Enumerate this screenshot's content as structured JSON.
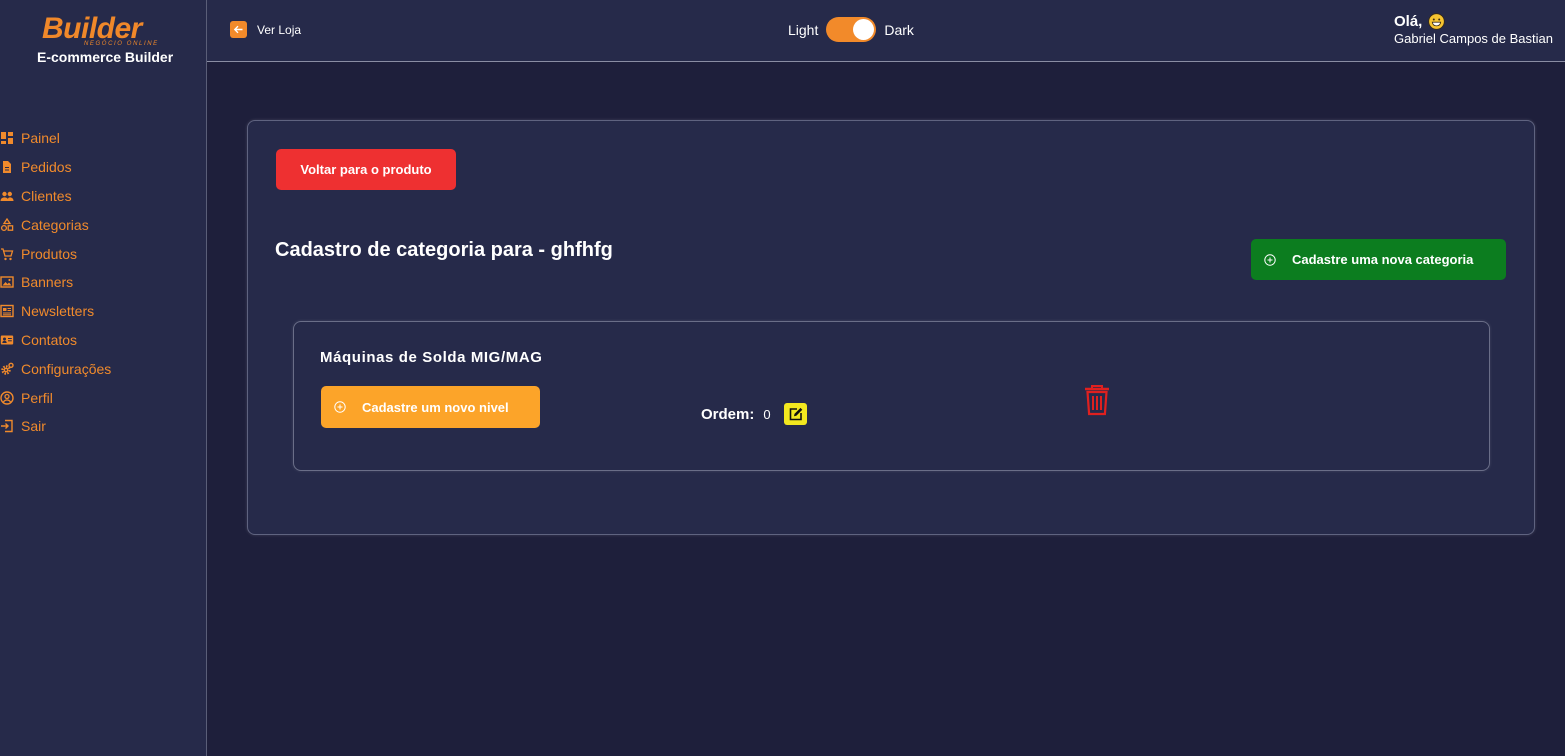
{
  "brand": {
    "logo_word": "Builder",
    "logo_tagline": "NEGÓCIO ONLINE",
    "subtitle": "E-commerce Builder"
  },
  "sidebar": {
    "items": [
      {
        "label": "Painel",
        "icon": "dashboard-icon"
      },
      {
        "label": "Pedidos",
        "icon": "document-icon"
      },
      {
        "label": "Clientes",
        "icon": "people-icon"
      },
      {
        "label": "Categorias",
        "icon": "shapes-icon"
      },
      {
        "label": "Produtos",
        "icon": "cart-icon"
      },
      {
        "label": "Banners",
        "icon": "image-icon"
      },
      {
        "label": "Newsletters",
        "icon": "newspaper-icon"
      },
      {
        "label": "Contatos",
        "icon": "contact-card-icon"
      },
      {
        "label": "Configurações",
        "icon": "gear-icon"
      },
      {
        "label": "Perfil",
        "icon": "user-circle-icon"
      },
      {
        "label": "Sair",
        "icon": "logout-icon"
      }
    ]
  },
  "header": {
    "ver_loja": "Ver Loja",
    "theme_light": "Light",
    "theme_dark": "Dark",
    "theme_mode": "dark",
    "greeting": "Olá,",
    "user_name": "Gabriel Campos de Bastian"
  },
  "main": {
    "back_button": "Voltar para o produto",
    "title": "Cadastro de categoria para - ghfhfg",
    "new_category_button": "Cadastre uma nova categoria",
    "category": {
      "name": "Máquinas de Solda MIG/MAG",
      "new_level_button": "Cadastre um novo nivel",
      "order_label": "Ordem:",
      "order_value": "0"
    }
  },
  "colors": {
    "accent": "#f08a2c",
    "background": "#1e1f3b",
    "panel": "#262a4a",
    "danger": "#ee3031",
    "success": "#0c7d1f",
    "warning": "#fca429",
    "edit": "#f3e81f"
  }
}
